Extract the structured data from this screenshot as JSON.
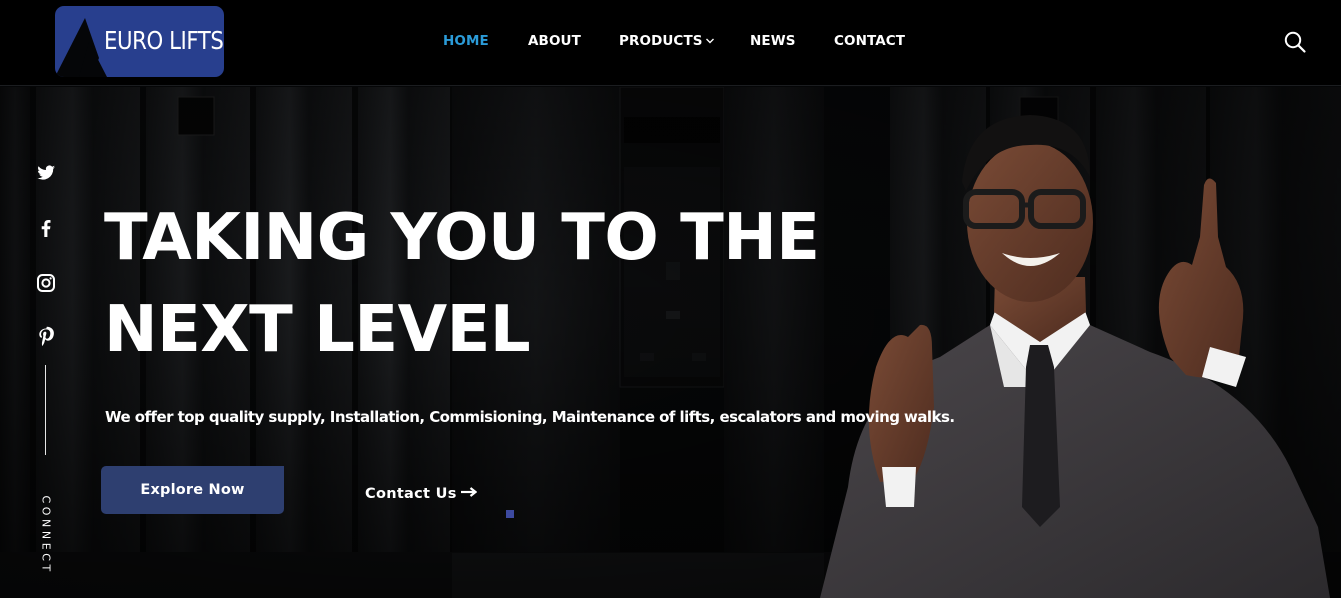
{
  "brand": {
    "name": "EURO LIFTS",
    "logo_color": "#283f8e"
  },
  "nav": {
    "items": [
      {
        "label": "HOME",
        "active": true
      },
      {
        "label": "ABOUT",
        "active": false
      },
      {
        "label": "PRODUCTS",
        "active": false,
        "has_dropdown": true
      },
      {
        "label": "NEWS",
        "active": false
      },
      {
        "label": "CONTACT",
        "active": false
      }
    ],
    "active_color": "#2b9bd8",
    "search_icon": "search-icon"
  },
  "social": {
    "icons": [
      "twitter-icon",
      "facebook-icon",
      "instagram-icon",
      "pinterest-icon"
    ],
    "label": "CONNECT"
  },
  "hero": {
    "title_line1": "TAKING YOU TO THE",
    "title_line2": "NEXT LEVEL",
    "subtitle": "We offer top quality supply, Installation, Commisioning, Maintenance of lifts, escalators and moving walks.",
    "primary_button": "Explore Now",
    "secondary_button": "Contact Us",
    "button_color": "#2e3f70",
    "slide_indicator_color": "#3d4aa0"
  }
}
